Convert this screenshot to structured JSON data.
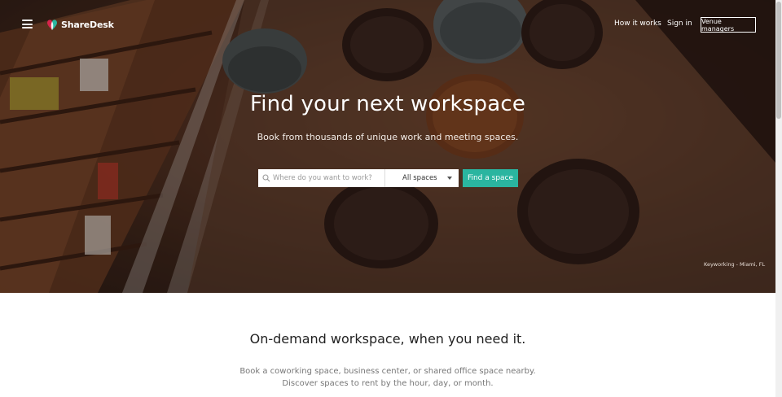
{
  "header": {
    "brand": "ShareDesk",
    "nav": {
      "how_it_works": "How it works",
      "sign_in": "Sign in",
      "venue_managers": "Venue managers"
    }
  },
  "hero": {
    "title": "Find your next workspace",
    "subtitle": "Book from thousands of unique work and meeting spaces.",
    "search": {
      "placeholder": "Where do you want to work?",
      "select_value": "All spaces",
      "button": "Find a space"
    },
    "photo_caption": "Keyworking - Miami, FL"
  },
  "section": {
    "title": "On-demand workspace, when you need it.",
    "line1": "Book a coworking space, business center, or shared office space nearby.",
    "line2": "Discover spaces to rent by the hour, day, or month."
  },
  "colors": {
    "accent": "#2ab5a0",
    "logo_red": "#d6244c",
    "logo_green": "#2ab5a0"
  },
  "icons": [
    "menu-icon",
    "search-icon",
    "chevron-down-icon"
  ]
}
